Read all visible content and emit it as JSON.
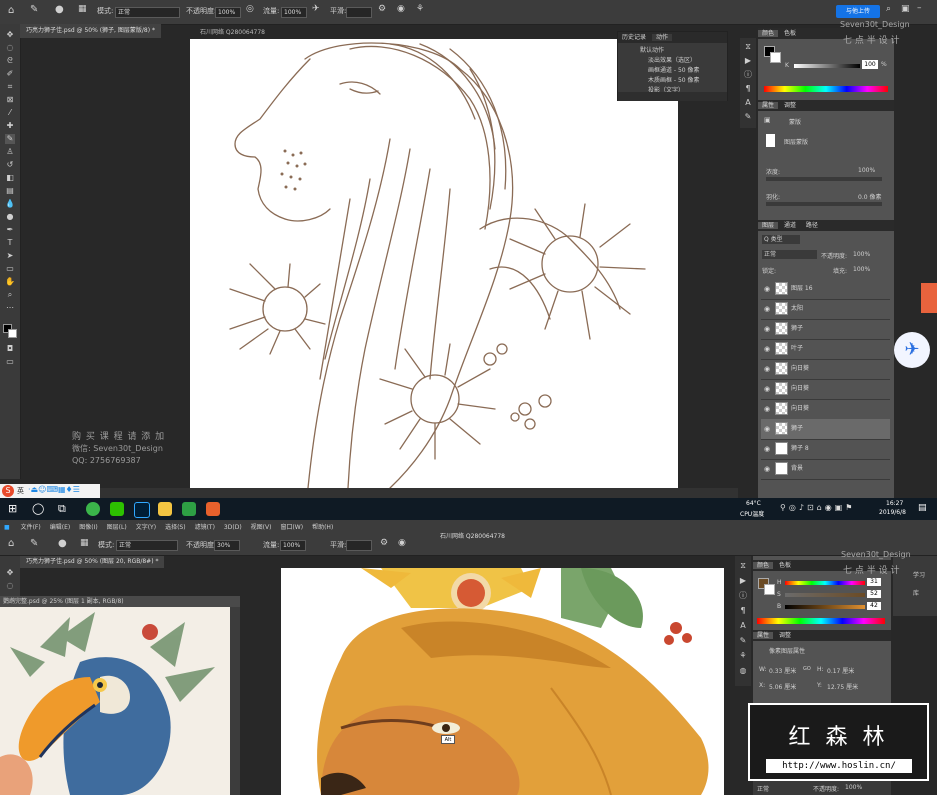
{
  "top": {
    "options": {
      "mode_label": "模式:",
      "mode_value": "正常",
      "opacity_label": "不透明度:",
      "opacity_value": "100%",
      "flow_label": "流量:",
      "flow_value": "100%",
      "smooth_label": "平滑:",
      "share_button": "与他上传"
    },
    "doc_tab": "巧亮力狮子佳.psd @ 50% (狮子, 图层蒙版/8) *",
    "watermark_id": "石川网络 Q280064778",
    "history_panel": {
      "tabs": [
        "历史记录",
        "动作"
      ],
      "items": [
        "默认动作",
        "淡出效果（选区）",
        "画框通道 - 50 像素",
        "木质画框 - 50 像素",
        "投影（文字）"
      ]
    },
    "color_panel": {
      "tabs": [
        "颜色",
        "色板"
      ],
      "k_label": "K",
      "k_value": "100",
      "pct": "%"
    },
    "properties_panel": {
      "tabs": [
        "属性",
        "调整"
      ],
      "mask_label": "蒙版",
      "layer_mask_label": "图层蒙版",
      "density_label": "浓度:",
      "density_value": "100%",
      "feather_label": "羽化:",
      "feather_value": "0.0 像素"
    },
    "layers_panel": {
      "tabs": [
        "图层",
        "通道",
        "路径"
      ],
      "kind_label": "Q 类型",
      "blend_mode": "正常",
      "opacity_label": "不透明度:",
      "opacity_value": "100%",
      "lock_label": "锁定:",
      "fill_label": "填充:",
      "fill_value": "100%",
      "layers": [
        {
          "name": "图层 16"
        },
        {
          "name": "太阳"
        },
        {
          "name": "狮子"
        },
        {
          "name": "叶子"
        },
        {
          "name": "向日葵"
        },
        {
          "name": "向日葵"
        },
        {
          "name": "向日葵"
        },
        {
          "name": "狮子"
        },
        {
          "name": "狮子 8"
        },
        {
          "name": "背景"
        }
      ]
    },
    "seven_watermark": {
      "name": "Seven30t_Design",
      "cn": "七 点 半 设 计"
    },
    "ad": {
      "line1": "购 买 课 程 请 添 加",
      "line2": "微信: Seven30t_Design",
      "line3": "QQ: 2756769387"
    },
    "ime_label": "英",
    "taskbar": {
      "weather": "64°C",
      "weather_sub": "CPU温度",
      "time": "16:27",
      "date": "2019/6/8"
    }
  },
  "bottom": {
    "menu": [
      "文件(F)",
      "编辑(E)",
      "图像(I)",
      "图层(L)",
      "文字(Y)",
      "选择(S)",
      "滤镜(T)",
      "3D(D)",
      "视图(V)",
      "窗口(W)",
      "帮助(H)"
    ],
    "options": {
      "mode_label": "模式:",
      "mode_value": "正常",
      "opacity_label": "不透明度:",
      "opacity_value": "30%",
      "flow_label": "流量:",
      "flow_value": "100%",
      "smooth_label": "平滑:"
    },
    "watermark_id": "石川网络 Q280064778",
    "doc_tab": "巧亮力狮子佳.psd @ 50% (图层 20, RGB/8#) *",
    "ref_doc_tab": "鹦鹉完整.psd @ 25% (图层 1 副本, RGB/8)",
    "color_panel": {
      "tabs": [
        "颜色",
        "色板"
      ],
      "h_label": "H",
      "h_value": "31",
      "s_label": "S",
      "s_value": "52",
      "b_label": "B",
      "b_value": "42",
      "pct": "%"
    },
    "properties_panel": {
      "tabs": [
        "属性",
        "调整"
      ],
      "title": "像素图层属性",
      "w_label": "W:",
      "w_value": "0.33 厘米",
      "h_label": "H:",
      "h_value": "0.17 厘米",
      "go_label": "GO",
      "x_label": "X:",
      "x_value": "5.06 厘米",
      "y_label": "Y:",
      "y_value": "12.75 厘米"
    },
    "side_labels": [
      "学习",
      "库"
    ],
    "seven_watermark": {
      "name": "Seven30t_Design",
      "cn": "七 点 半 设 计"
    },
    "tooltip": "Alt",
    "layers_strip": {
      "blend_mode": "正常",
      "opacity_label": "不透明度:",
      "opacity_value": "100%"
    }
  },
  "brand_overlay": {
    "title": "红 森 林",
    "url": "http://www.hoslin.cn/"
  },
  "colors": {
    "panel_bg": "#535353",
    "canvas_bg": "#282828",
    "accent_blue": "#1473e6",
    "line_art": "#8a6b55",
    "lion_orange": "#e0a23c"
  }
}
